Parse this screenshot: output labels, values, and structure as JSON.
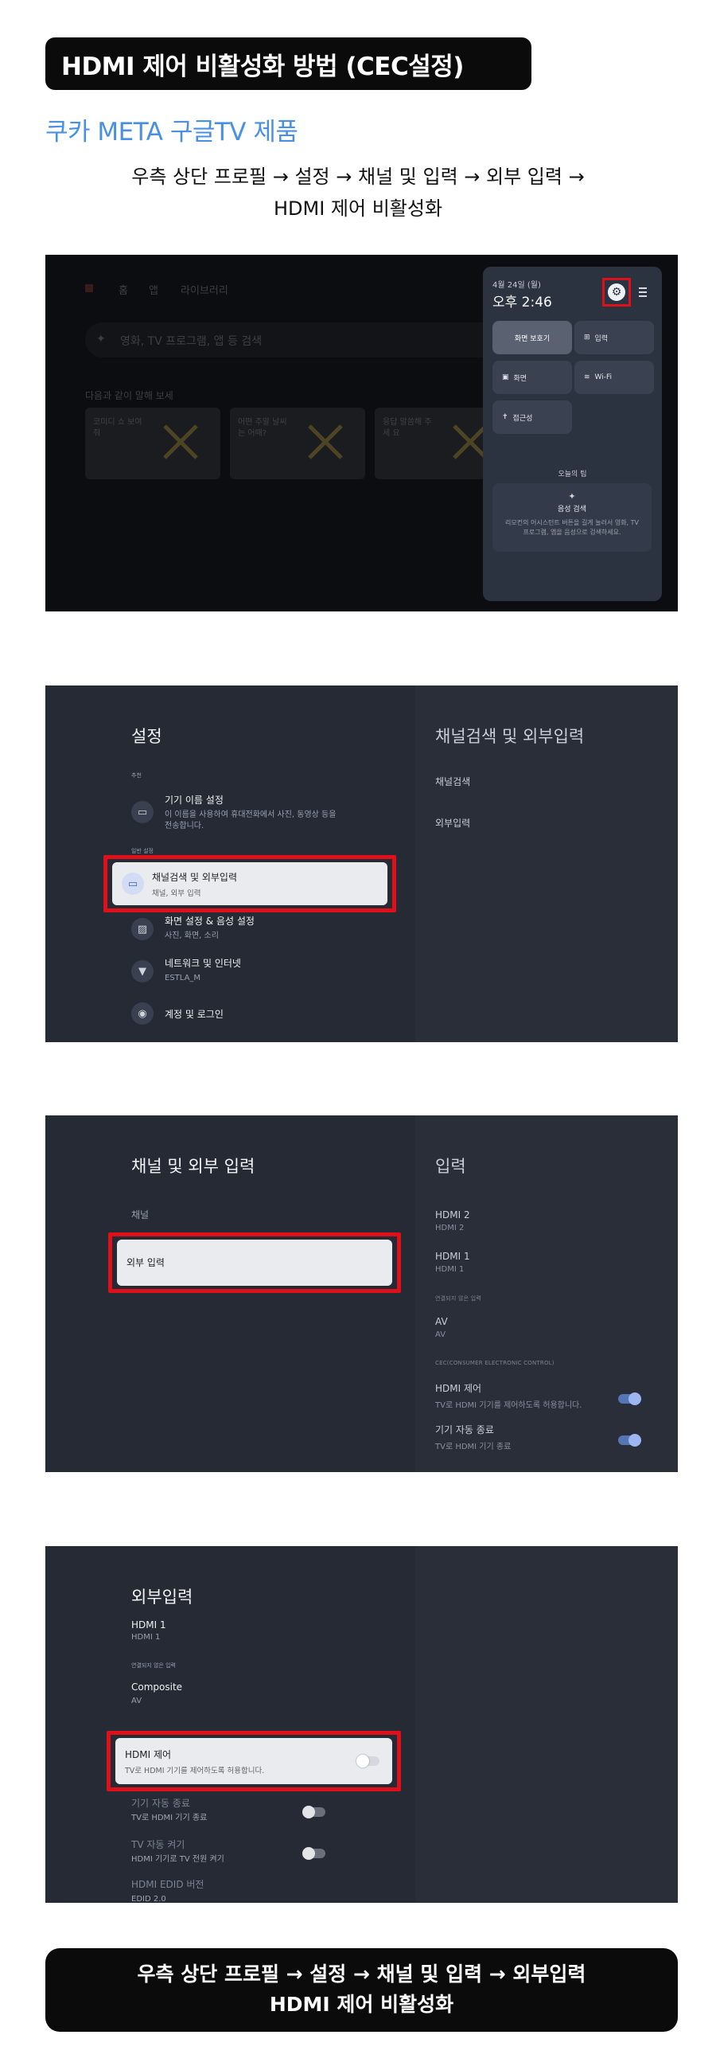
{
  "header": {
    "title": "HDMI 제어 비활성화 방법 (CEC설정)",
    "subtitle": "쿠카 META 구글TV 제품",
    "instruction_line1": "우측 상단 프로필 → 설정 → 채널 및 입력 → 외부 입력 →",
    "instruction_line2": "HDMI 제어 비활성화"
  },
  "step1": {
    "nav": [
      "홈",
      "앱",
      "라이브러리"
    ],
    "search_placeholder": "영화, TV 프로그램, 앱 등 검색",
    "section": "다음과 같이 말해 보세",
    "cards": [
      "코미디 쇼 보여줘",
      "어떤 주말 날씨는 어때?",
      "응답 말씀해 주세 요"
    ],
    "quick_settings": {
      "date": "4월 24일 (월)",
      "time": "오후 2:46",
      "tiles": [
        "화면 보호기",
        "입력",
        "화면",
        "Wi-Fi",
        "접근성"
      ],
      "tip_title": "오늘의 팁",
      "tip_heading": "음성 검색",
      "tip_body": "리모컨의 어시스턴트 버튼을 길게 눌러서 영화, TV 프로그램, 앱을 음성으로 검색하세요."
    }
  },
  "step2": {
    "title": "설정",
    "label_recommended": "추천",
    "label_general": "일반 설정",
    "items": [
      {
        "title": "기기 이름 설정",
        "sub": "이 이름을 사용하여 휴대전화에서 사진, 동영상 등을 전송합니다."
      },
      {
        "title": "채널검색 및 외부입력",
        "sub": "채널, 외부 입력"
      },
      {
        "title": "화면 설정 & 음성 설정",
        "sub": "사진, 화면, 소리"
      },
      {
        "title": "네트워크 및 인터넷",
        "sub": "ESTLA_M"
      },
      {
        "title": "계정 및 로그인",
        "sub": ""
      }
    ],
    "right_title": "채널검색 및 외부입력",
    "right_items": [
      "채널검색",
      "외부입력"
    ]
  },
  "step3": {
    "title": "채널 및 외부 입력",
    "item_channel": "채널",
    "item_external": "외부 입력",
    "right_title": "입력",
    "right_items": [
      {
        "title": "HDMI 2",
        "sub": "HDMI 2"
      },
      {
        "title": "HDMI 1",
        "sub": "HDMI 1"
      },
      {
        "title": "AV",
        "sub": "AV"
      }
    ],
    "label_unconnected": "연결되지 않은 입력",
    "label_cec": "CEC(CONSUMER ELECTRONIC CONTROL)",
    "hdmi_control": {
      "title": "HDMI 제어",
      "sub": "TV로 HDMI 기기를 제어하도록 허용합니다."
    },
    "auto_off": {
      "title": "기기 자동 종료",
      "sub": "TV로 HDMI 기기 종료"
    }
  },
  "step4": {
    "title": "외부입력",
    "hdmi1": {
      "title": "HDMI 1",
      "sub": "HDMI 1"
    },
    "label_unconnected": "연결되지 않은 입력",
    "composite": {
      "title": "Composite",
      "sub": "AV"
    },
    "hdmi_control": {
      "title": "HDMI 제어",
      "sub": "TV로 HDMI 기기를 제어하도록 허용합니다."
    },
    "auto_off": {
      "title": "기기 자동 종료",
      "sub": "TV로 HDMI 기기 종료"
    },
    "tv_auto_on": {
      "title": "TV 자동 켜기",
      "sub": "HDMI 기기로 TV 전원 켜기"
    },
    "edid": {
      "title": "HDMI EDID 버전",
      "sub": "EDID 2.0"
    }
  },
  "footer": {
    "line1": "우측 상단 프로필 → 설정 → 채널 및 입력 → 외부입력",
    "line2": "HDMI 제어 비활성화"
  },
  "colors": {
    "highlight": "#e0101a",
    "subtitle": "#4a90e2",
    "panel": "#252a35"
  }
}
